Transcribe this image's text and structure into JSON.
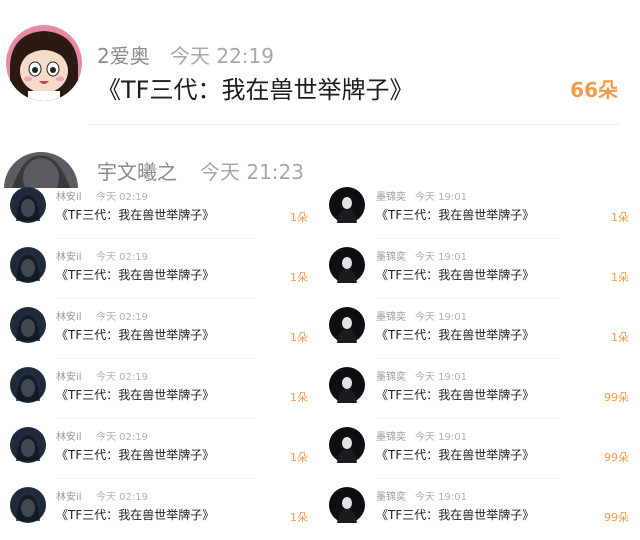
{
  "top_entry": {
    "name": "2爱奥",
    "time": "今天 22:19",
    "gift": "《TF三代：我在兽世举牌子》",
    "count": "66朵"
  },
  "second_entry": {
    "name": "宇文曦之",
    "time": "今天 21:23"
  },
  "left_column": [
    {
      "name": "林安il",
      "time": "今天 02:19",
      "gift": "《TF三代：我在兽世举牌子》",
      "count": "1朵"
    },
    {
      "name": "林安il",
      "time": "今天 02:19",
      "gift": "《TF三代：我在兽世举牌子》",
      "count": "1朵"
    },
    {
      "name": "林安il",
      "time": "今天 02:19",
      "gift": "《TF三代：我在兽世举牌子》",
      "count": "1朵"
    },
    {
      "name": "林安il",
      "time": "今天 02:19",
      "gift": "《TF三代：我在兽世举牌子》",
      "count": "1朵"
    },
    {
      "name": "林安il",
      "time": "今天 02:19",
      "gift": "《TF三代：我在兽世举牌子》",
      "count": "1朵"
    },
    {
      "name": "林安il",
      "time": "今天 02:19",
      "gift": "《TF三代：我在兽世举牌子》",
      "count": "1朵"
    }
  ],
  "right_column": [
    {
      "name": "墨锦奕",
      "time": "今天 19:01",
      "gift": "《TF三代：我在兽世举牌子》",
      "count": "1朵"
    },
    {
      "name": "墨锦奕",
      "time": "今天 19:01",
      "gift": "《TF三代：我在兽世举牌子》",
      "count": "1朵"
    },
    {
      "name": "墨锦奕",
      "time": "今天 19:01",
      "gift": "《TF三代：我在兽世举牌子》",
      "count": "1朵"
    },
    {
      "name": "墨锦奕",
      "time": "今天 19:01",
      "gift": "《TF三代：我在兽世举牌子》",
      "count": "99朵"
    },
    {
      "name": "墨锦奕",
      "time": "今天 19:01",
      "gift": "《TF三代：我在兽世举牌子》",
      "count": "99朵"
    },
    {
      "name": "墨锦奕",
      "time": "今天 19:01",
      "gift": "《TF三代：我在兽世举牌子》",
      "count": "99朵"
    }
  ],
  "colors": {
    "accent": "#f59a4a",
    "name": "#8a8a8a",
    "time": "#a7a7a7",
    "text": "#1c1c1c"
  }
}
